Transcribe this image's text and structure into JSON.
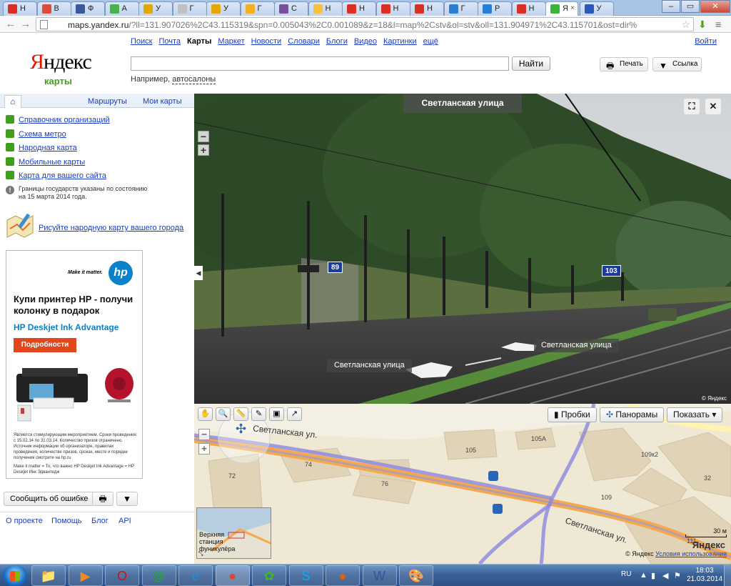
{
  "browser": {
    "tabs": [
      {
        "label": "Н",
        "color": "#d93025"
      },
      {
        "label": "В",
        "color": "#dd4b39"
      },
      {
        "label": "Ф",
        "color": "#3b5998"
      },
      {
        "label": "А",
        "color": "#4caf50"
      },
      {
        "label": "У",
        "color": "#e0a800"
      },
      {
        "label": "Г",
        "color": "#c0c0c0"
      },
      {
        "label": "У",
        "color": "#e0a800"
      },
      {
        "label": "Г",
        "color": "#f2b01e"
      },
      {
        "label": "С",
        "color": "#7a4f9e"
      },
      {
        "label": "Н",
        "color": "#f6c23e"
      },
      {
        "label": "Н",
        "color": "#d93025"
      },
      {
        "label": "Н",
        "color": "#d93025"
      },
      {
        "label": "Н",
        "color": "#d93025"
      },
      {
        "label": "Г",
        "color": "#2a7fd4"
      },
      {
        "label": "Р",
        "color": "#2a7fd4"
      },
      {
        "label": "Н",
        "color": "#d93025"
      },
      {
        "label": "Я",
        "color": "#3cb43c",
        "active": true,
        "close": "×"
      },
      {
        "label": "У",
        "color": "#2a5ab8"
      }
    ],
    "window_controls": {
      "minimize": "–",
      "maximize": "▭",
      "close": "✕"
    },
    "nav": {
      "back": "←",
      "forward": "→",
      "reload": "↻"
    },
    "url_host": "maps.yandex.ru",
    "url_rest": "/?ll=131.907026%2C43.115319&spn=0.005043%2C0.001089&z=18&l=map%2Cstv&ol=stv&oll=131.904971%2C43.115701&ost=dir%",
    "extension_icon": "download-arrow-icon",
    "menu_icon": "wrench-icon"
  },
  "header": {
    "logo_y": "Я",
    "logo_rest": "ндекс",
    "logo_sub": "карты",
    "services": [
      "Поиск",
      "Почта",
      "Карты",
      "Маркет",
      "Новости",
      "Словари",
      "Блоги",
      "Видео",
      "Картинки"
    ],
    "current_service": "Карты",
    "more": "ещё",
    "login": "Войти",
    "search_value": "",
    "find_button": "Найти",
    "example_prefix": "Например,",
    "example_link": "автосалоны",
    "print_button": "Печать",
    "link_button": "Ссылка"
  },
  "left": {
    "tabs": {
      "home": "⌂",
      "routes": "Маршруты",
      "mymaps": "Мои карты"
    },
    "menu": [
      {
        "label": "Справочник организаций",
        "color": "#3f9e1b",
        "icon": "directory-icon"
      },
      {
        "label": "Схема метро",
        "color": "#3f9e1b",
        "icon": "metro-icon"
      },
      {
        "label": "Народная карта",
        "color": "#3f9e1b",
        "icon": "people-map-icon"
      },
      {
        "label": "Мобильные карты",
        "color": "#3f9e1b",
        "icon": "mobile-icon"
      },
      {
        "label": "Карта для вашего сайта",
        "color": "#3f9e1b",
        "icon": "site-map-icon"
      }
    ],
    "notice_mark": "!",
    "notice": "Границы государств указаны по состоянию на 15 марта 2014 года.",
    "promo": "Рисуйте народную карту вашего города",
    "ad": {
      "tagline": "Make it matter.",
      "logo": "hp",
      "headline": "Купи принтер HP - получи колонку в подарок",
      "product": "HP Deskjet Ink Advantage",
      "button": "Подробности",
      "fine": "Является стимулирующим мероприятием. Сроки проведения: с 15.02.14 по 31.03.14. Количество призов ограничено. Источник информации об организаторе, правилах проведения, количестве призов, сроках, месте и порядке получения смотрите на hp.ru",
      "fine2": "Make it matter = То, что важно\nHP Deskjet Ink Advantage = HP Deskjet Инк Эдвантедж"
    },
    "report_button": "Сообщить об ошибке",
    "print_icon": "printer-icon",
    "link_icon": "link-icon",
    "footer": [
      "О проекте",
      "Помощь",
      "Блог",
      "API"
    ]
  },
  "panorama": {
    "title": "Светланская улица",
    "house_numbers": [
      "89",
      "103"
    ],
    "street_labels": [
      "Светланская улица",
      "Светланская улица"
    ],
    "copyright": "© Яндекс"
  },
  "map": {
    "tools": [
      "✋",
      "🔍",
      "📏",
      "✎",
      "▣",
      "↗"
    ],
    "traffic": "Пробки",
    "panoramas": "Панорамы",
    "show": "Показать ▾",
    "buildings": [
      "105",
      "105А",
      "74",
      "76",
      "72",
      "109к2",
      "109",
      "32",
      "111"
    ],
    "street": "Светланская ул.",
    "street2": "Светланская ул.",
    "minimap_label": "Верхняя станция фуникулёра",
    "scale": "30 м",
    "copy_prefix": "© Яндекс",
    "copy_link": "Условия использования",
    "logo": "Яндекс"
  },
  "taskbar": {
    "apps": [
      {
        "name": "explorer",
        "glyph": "📁",
        "color": "#f0c050"
      },
      {
        "name": "media",
        "glyph": "▶",
        "color": "#f08a1e"
      },
      {
        "name": "opera",
        "glyph": "O",
        "color": "#d01010"
      },
      {
        "name": "agent",
        "glyph": "@",
        "color": "#1bb01b"
      },
      {
        "name": "ie",
        "glyph": "e",
        "color": "#2a8ad4"
      },
      {
        "name": "chrome",
        "glyph": "●",
        "color": "#db4437"
      },
      {
        "name": "icq",
        "glyph": "✿",
        "color": "#41b32d"
      },
      {
        "name": "skype",
        "glyph": "S",
        "color": "#00aff0"
      },
      {
        "name": "firefox",
        "glyph": "●",
        "color": "#e66000"
      },
      {
        "name": "word",
        "glyph": "W",
        "color": "#2b5797"
      },
      {
        "name": "paint",
        "glyph": "🎨",
        "color": "#f0c050"
      }
    ],
    "lang": "RU",
    "time": "18:03",
    "date": "21.03.2014"
  }
}
